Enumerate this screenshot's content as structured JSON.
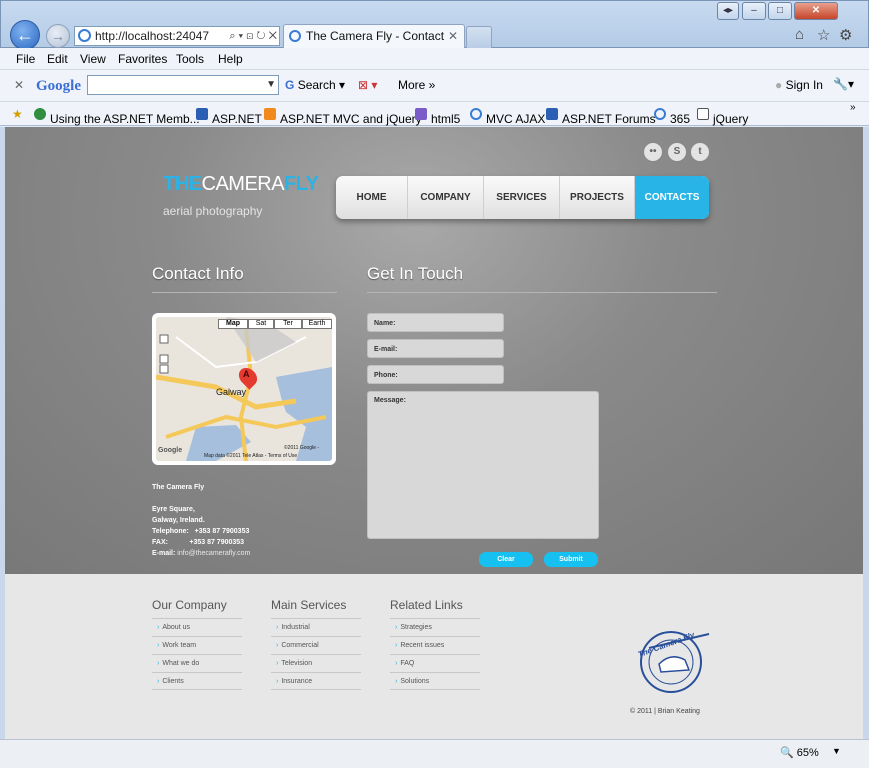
{
  "browser": {
    "address": "http://localhost:24047",
    "tab_title": "The Camera Fly - Contact",
    "menu": [
      "File",
      "Edit",
      "View",
      "Favorites",
      "Tools",
      "Help"
    ],
    "google_label": "Google",
    "search_label": "Search",
    "more_label": "More »",
    "sign_in_label": "Sign In",
    "favorites": [
      "Using the ASP.NET Memb...",
      "ASP.NET",
      "ASP.NET MVC and jQuery",
      "html5",
      "MVC AJAX",
      "ASP.NET Forums",
      "365",
      "jQuery"
    ],
    "zoom": "65%"
  },
  "site": {
    "logo_prefix": "THE",
    "logo_mid": "CAMERA",
    "logo_suffix": "FLY",
    "tagline": "aerial photography",
    "nav": [
      "HOME",
      "COMPANY",
      "SERVICES",
      "PROJECTS",
      "CONTACTS"
    ],
    "active_nav": "CONTACTS"
  },
  "contact": {
    "heading": "Contact Info",
    "map_tabs": [
      "Map",
      "Sat",
      "Ter",
      "Earth"
    ],
    "map_city": "Galway",
    "map_marker": "A",
    "map_credit": "Map data ©2011 Tele Atlas - Terms of Use",
    "map_copyright": "©2011 Google -",
    "company": "The Camera Fly",
    "street": "Eyre Square,",
    "city": "Galway, Ireland.",
    "telephone_label": "Telephone:",
    "telephone": "+353 87 7900353",
    "fax_label": "FAX:",
    "fax": "+353 87 7900353",
    "email_label": "E-mail:",
    "email": "info@thecamerafly.com"
  },
  "form": {
    "heading": "Get In Touch",
    "name_label": "Name:",
    "email_label": "E-mail:",
    "phone_label": "Phone:",
    "message_label": "Message:",
    "clear_label": "Clear",
    "submit_label": "Submit"
  },
  "footer": {
    "cols": [
      {
        "title": "Our Company",
        "items": [
          "About us",
          "Work team",
          "What we do",
          "Clients"
        ]
      },
      {
        "title": "Main Services",
        "items": [
          "Industrial",
          "Commercial",
          "Television",
          "Insurance"
        ]
      },
      {
        "title": "Related Links",
        "items": [
          "Strategies",
          "Recent issues",
          "FAQ",
          "Solutions"
        ]
      }
    ],
    "badge_text": "The Camera Fly",
    "copyright": "© 2011 | Brian Keating"
  },
  "colors": {
    "accent": "#29b4e8",
    "button": "#16c0f0",
    "hero_bg": "#8a8a8a",
    "footer_bg": "#e7e7e7"
  }
}
